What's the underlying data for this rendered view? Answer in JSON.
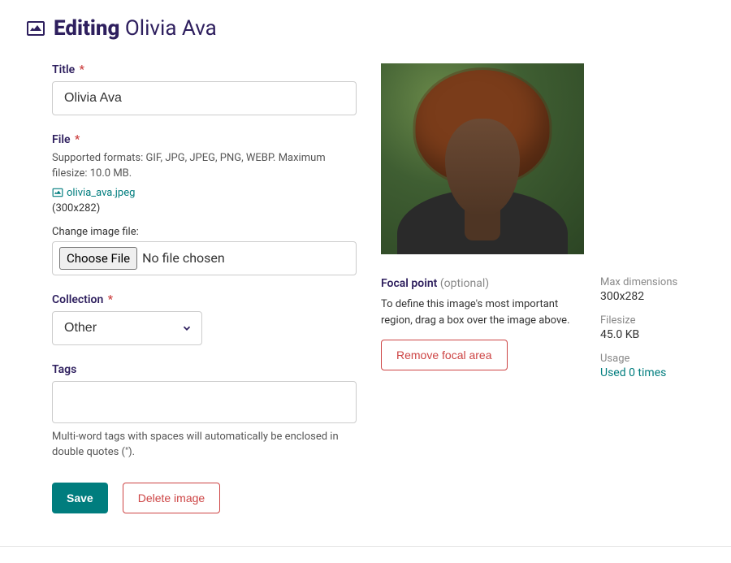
{
  "header": {
    "editing_label": "Editing",
    "image_name": "Olivia Ava"
  },
  "fields": {
    "title": {
      "label": "Title",
      "required_mark": "*",
      "value": "Olivia Ava"
    },
    "file": {
      "label": "File",
      "required_mark": "*",
      "help": "Supported formats: GIF, JPG, JPEG, PNG, WEBP. Maximum filesize: 10.0 MB.",
      "filename": "olivia_ava.jpeg",
      "dimensions": "(300x282)",
      "change_label": "Change image file:",
      "choose_button": "Choose File",
      "no_file_text": "No file chosen"
    },
    "collection": {
      "label": "Collection",
      "required_mark": "*",
      "value": "Other"
    },
    "tags": {
      "label": "Tags",
      "help": "Multi-word tags with spaces will automatically be enclosed in double quotes (\")."
    }
  },
  "actions": {
    "save": "Save",
    "delete": "Delete image"
  },
  "focal": {
    "label": "Focal point",
    "optional": "(optional)",
    "help": "To define this image's most important region, drag a box over the image above.",
    "remove_button": "Remove focal area"
  },
  "meta": {
    "max_dim_label": "Max dimensions",
    "max_dim_value": "300x282",
    "filesize_label": "Filesize",
    "filesize_value": "45.0 KB",
    "usage_label": "Usage",
    "usage_link": "Used 0 times"
  }
}
